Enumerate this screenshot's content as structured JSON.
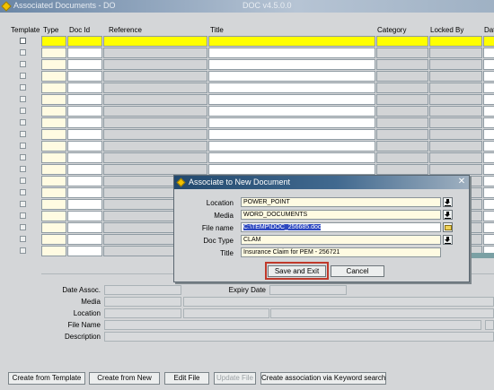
{
  "window": {
    "title_left": "Associated Documents - DO",
    "title_right": "DOC v4.5.0.0"
  },
  "grid": {
    "headers": {
      "template": "Template",
      "type": "Type",
      "doc_id": "Doc Id",
      "reference": "Reference",
      "title": "Title",
      "category": "Category",
      "locked_by": "Locked By",
      "date": "Dat"
    },
    "row_count": 19
  },
  "detail": {
    "date_assoc_label": "Date Assoc.",
    "expiry_date_label": "Expiry Date",
    "media_label": "Media",
    "location_label": "Location",
    "file_name_label": "File Name",
    "description_label": "Description"
  },
  "buttons": {
    "create_from_template": "Create from Template",
    "create_from_new": "Create from New",
    "edit_file": "Edit File",
    "update_file": "Update File",
    "create_assoc_keyword": "Create association via Keyword search"
  },
  "dialog": {
    "title": "Associate to New Document",
    "close_glyph": "✕",
    "fields": {
      "location_label": "Location",
      "location_value": "POWER_POINT",
      "media_label": "Media",
      "media_value": "WORD_DOCUMENTS",
      "file_name_label": "File name",
      "file_name_value": "C:\\TEMP\\DOC_256685.doc",
      "doc_type_label": "Doc Type",
      "doc_type_value": "CLAM",
      "title_label": "Title",
      "title_value": "Insurance Claim for PEM - 256721"
    },
    "save_and_exit": "Save and Exit",
    "cancel": "Cancel"
  },
  "colors": {
    "selected_row": "#ffff00",
    "pale_yellow_cell": "#fffbe2",
    "highlight_box": "#c0392b",
    "dialog_title_bar": "#22496e"
  },
  "icons": {
    "app": "diamond-app-icon",
    "dropdown": "down-arrow-icon",
    "browse": "folder-icon"
  }
}
